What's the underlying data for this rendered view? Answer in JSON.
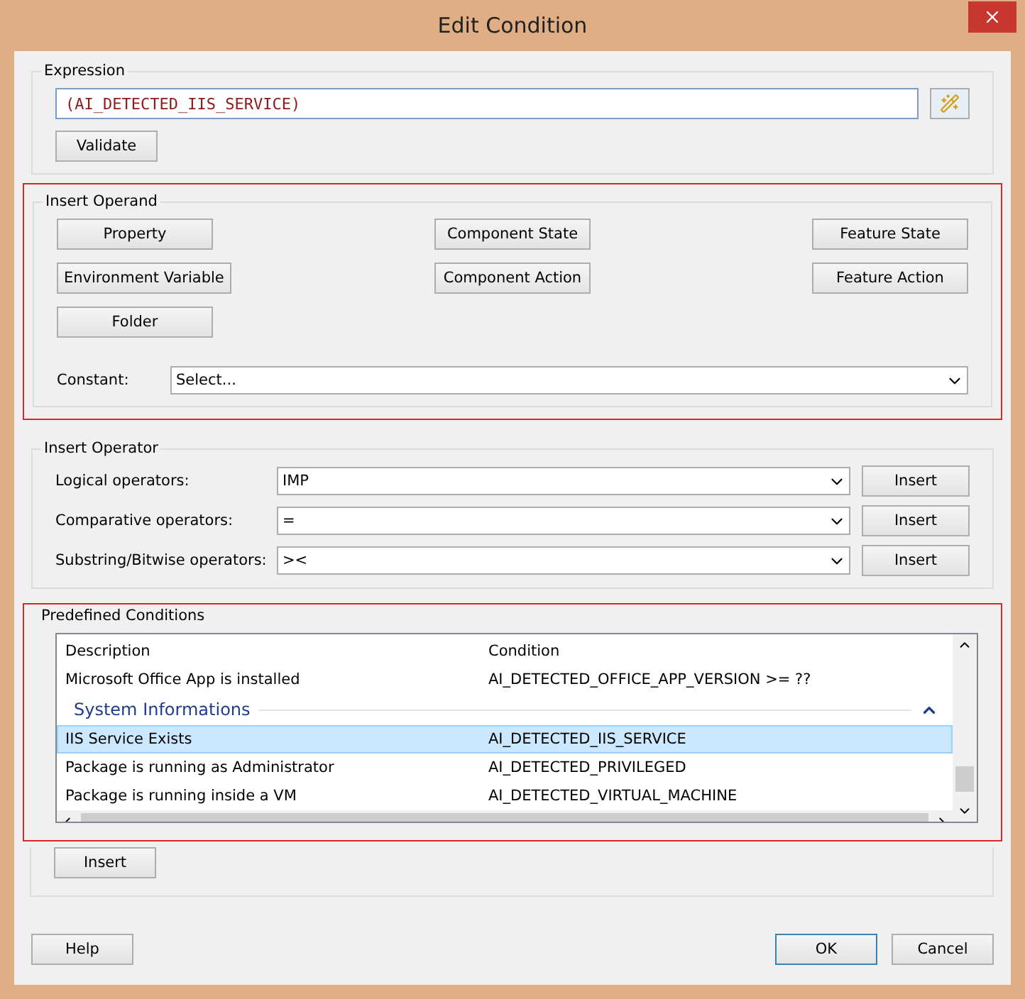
{
  "window": {
    "title": "Edit Condition"
  },
  "expression": {
    "label": "Expression",
    "value": "(AI_DETECTED_IIS_SERVICE)",
    "validate": "Validate"
  },
  "insert_operand": {
    "label": "Insert Operand",
    "highlighted": true,
    "buttons": [
      "Property",
      "Component State",
      "Feature State",
      "Environment Variable",
      "Component Action",
      "Feature Action",
      "Folder"
    ],
    "constant": {
      "label": "Constant:",
      "value": "Select..."
    }
  },
  "insert_operator": {
    "label": "Insert Operator",
    "rows": [
      {
        "label": "Logical operators:",
        "value": "IMP",
        "button": "Insert"
      },
      {
        "label": "Comparative operators:",
        "value": "=",
        "button": "Insert"
      },
      {
        "label": "Substring/Bitwise operators:",
        "value": "><",
        "button": "Insert"
      }
    ]
  },
  "predefined": {
    "label": "Predefined Conditions",
    "highlighted": true,
    "columns": [
      "Description",
      "Condition"
    ],
    "rows": [
      {
        "kind": "row",
        "description": "Microsoft Office App is installed",
        "condition": "AI_DETECTED_OFFICE_APP_VERSION >= ??",
        "selected": false
      },
      {
        "kind": "group",
        "title": "System Informations",
        "expanded": true
      },
      {
        "kind": "row",
        "description": "IIS Service Exists",
        "condition": "AI_DETECTED_IIS_SERVICE",
        "selected": true
      },
      {
        "kind": "row",
        "description": "Package is running as Administrator",
        "condition": "AI_DETECTED_PRIVILEGED",
        "selected": false
      },
      {
        "kind": "row",
        "description": "Package is running inside a VM",
        "condition": "AI_DETECTED_VIRTUAL_MACHINE",
        "selected": false
      }
    ],
    "insert": "Insert"
  },
  "footer": [
    {
      "label": "Help",
      "default": false
    },
    {
      "label": "OK",
      "default": true
    },
    {
      "label": "Cancel",
      "default": false
    }
  ]
}
